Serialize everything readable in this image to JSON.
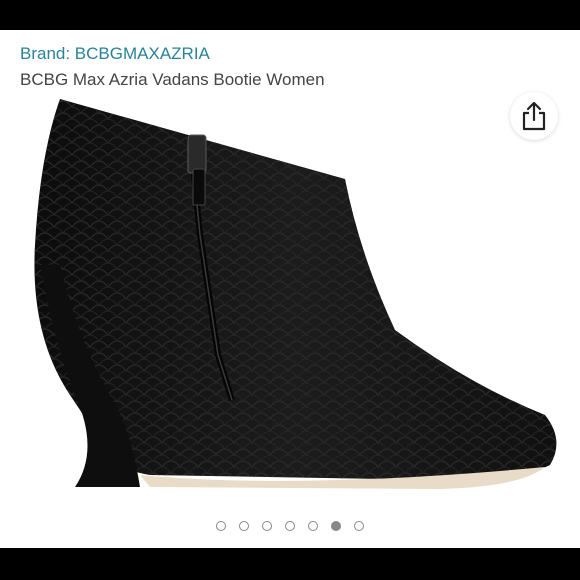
{
  "listing": {
    "brand": "Brand: BCBGMAXAZRIA",
    "title": "BCBG Max Azria Vadans Bootie Women"
  },
  "actions": {
    "share_icon": "share-icon"
  },
  "carousel": {
    "total": 7,
    "active_index": 5
  },
  "colors": {
    "brand_text": "#2a8299",
    "bootie": "#151515",
    "dot": "#888888"
  }
}
